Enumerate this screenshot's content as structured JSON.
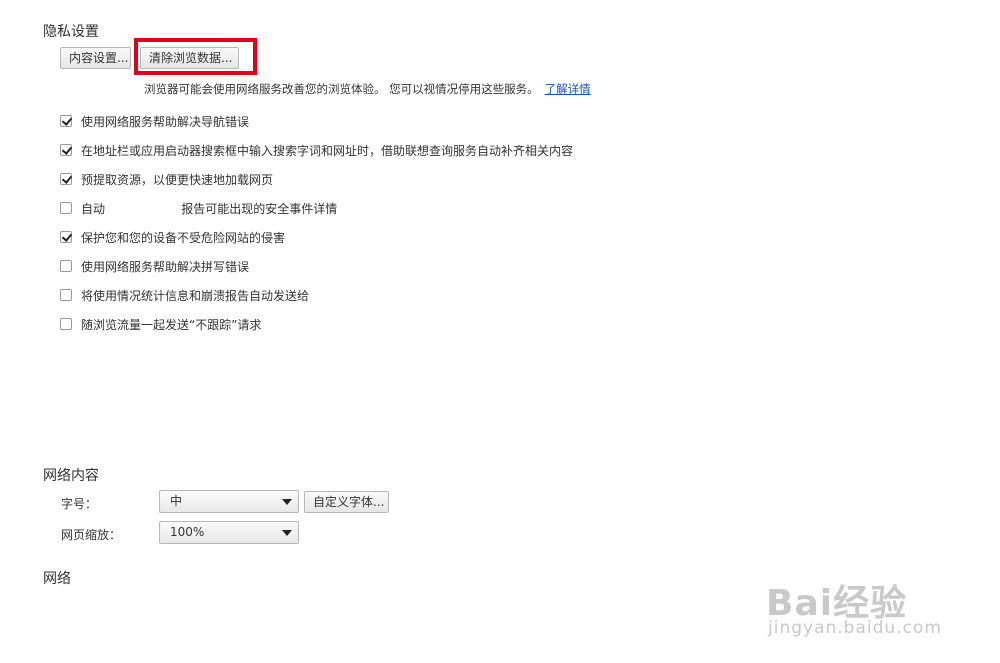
{
  "privacy": {
    "title": "隐私设置",
    "content_settings_button": "内容设置...",
    "clear_data_button": "清除浏览数据...",
    "note": "浏览器可能会使用网络服务改善您的浏览体验。 您可以视情况停用这些服务。",
    "learn_more": "了解详情",
    "options": [
      {
        "label": "使用网络服务帮助解决导航错误",
        "checked": true
      },
      {
        "label": "在地址栏或应用启动器搜索框中输入搜索字词和网址时，借助联想查询服务自动补齐相关内容",
        "checked": true
      },
      {
        "label": "预提取资源，以便更快速地加载网页",
        "checked": true
      },
      {
        "label": "自动                    报告可能出现的安全事件详情",
        "checked": false
      },
      {
        "label": "保护您和您的设备不受危险网站的侵害",
        "checked": true
      },
      {
        "label": "使用网络服务帮助解决拼写错误",
        "checked": false
      },
      {
        "label": "将使用情况统计信息和崩溃报告自动发送给",
        "checked": false
      },
      {
        "label": "随浏览流量一起发送“不跟踪”请求",
        "checked": false
      }
    ]
  },
  "web_content": {
    "title": "网络内容",
    "font_size_label": "字号：",
    "font_size_value": "中",
    "custom_fonts_button": "自定义字体...",
    "zoom_label": "网页缩放：",
    "zoom_value": "100%"
  },
  "network": {
    "title": "网络"
  },
  "watermark": {
    "brand": "Bai经验",
    "url": "jingyan.baidu.com"
  }
}
